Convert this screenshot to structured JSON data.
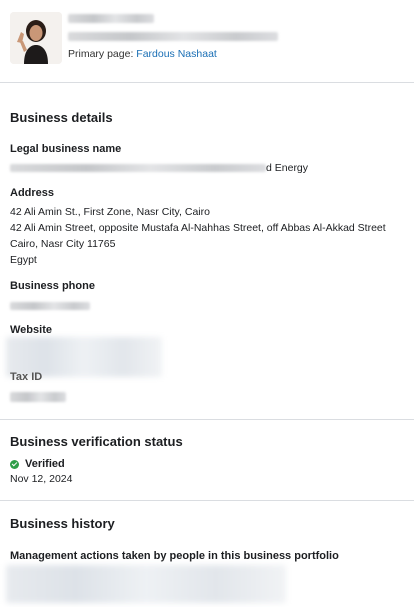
{
  "header": {
    "primary_page_label": "Primary page:",
    "primary_page_name": "Fardous Nashaat"
  },
  "business_details": {
    "heading": "Business details",
    "legal_name_label": "Legal business name",
    "legal_name_visible_tail": "d Energy",
    "address_label": "Address",
    "address_lines": [
      "42 Ali Amin St., First Zone, Nasr City, Cairo",
      "42 Ali Amin Street, opposite Mustafa Al-Nahhas Street, off Abbas Al-Akkad Street",
      "Cairo, Nasr City 11765",
      "Egypt"
    ],
    "phone_label": "Business phone",
    "website_label": "Website",
    "tax_id_label": "Tax ID"
  },
  "verification": {
    "heading": "Business verification status",
    "status": "Verified",
    "date": "Nov 12, 2024",
    "status_color": "#2e9e48"
  },
  "history": {
    "heading": "Business history",
    "subheading": "Management actions taken by people in this business portfolio"
  },
  "colors": {
    "link": "#1a6fb5",
    "divider": "#dadde1"
  },
  "icons": [
    "check-circle-icon"
  ]
}
